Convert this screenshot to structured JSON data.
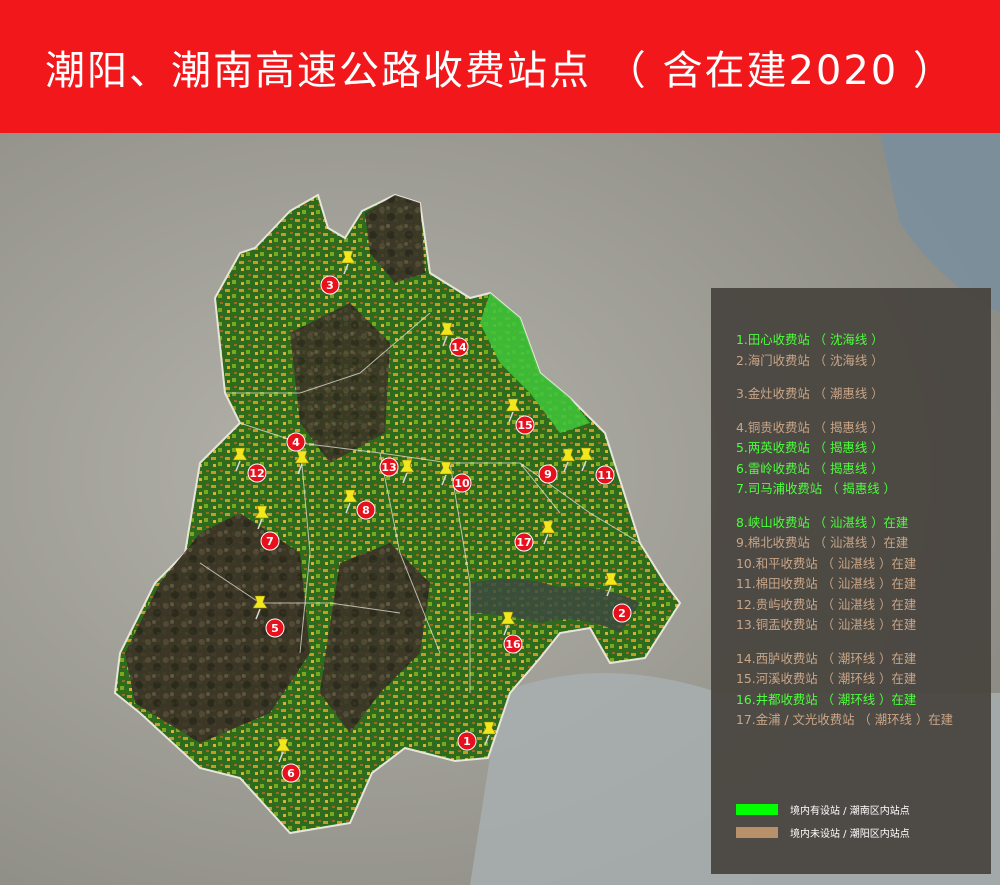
{
  "title": "潮阳、潮南高速公路收费站点 （ 含在建2020 ）",
  "colors": {
    "title_bar": "#f1171a",
    "green_text": "#4cff3c",
    "tan_text": "#c9a688",
    "legend_bg": "#46423d",
    "marker": "#e8101c",
    "pin": "#f2e61c",
    "key_green": "#00ff00",
    "key_tan": "#b8906a"
  },
  "legend": {
    "groups": [
      [
        {
          "text": "1.田心收费站 （ 沈海线 ）",
          "color": "green"
        },
        {
          "text": "2.海门收费站 （ 沈海线 ）",
          "color": "tan"
        }
      ],
      [
        {
          "text": "3.金灶收费站 （ 潮惠线 ）",
          "color": "tan"
        }
      ],
      [
        {
          "text": "4.铜贵收费站 （ 揭惠线 ）",
          "color": "tan"
        },
        {
          "text": "5.两英收费站 （ 揭惠线 ）",
          "color": "green"
        },
        {
          "text": "6.雷岭收费站 （ 揭惠线 ）",
          "color": "green"
        },
        {
          "text": "7.司马浦收费站 （ 揭惠线 ）",
          "color": "green"
        }
      ],
      [
        {
          "text": "8.峡山收费站 （ 汕湛线 ）在建",
          "color": "green"
        },
        {
          "text": "9.棉北收费站 （ 汕湛线 ）在建",
          "color": "tan"
        },
        {
          "text": "10.和平收费站 （ 汕湛线 ）在建",
          "color": "tan"
        },
        {
          "text": "11.棉田收费站 （ 汕湛线 ）在建",
          "color": "tan"
        },
        {
          "text": "12.贵屿收费站 （ 汕湛线 ）在建",
          "color": "tan"
        },
        {
          "text": "13.铜盂收费站 （ 汕湛线 ）在建",
          "color": "tan"
        }
      ],
      [
        {
          "text": "14.西胪收费站 （ 潮环线 ）在建",
          "color": "tan"
        },
        {
          "text": "15.河溪收费站 （ 潮环线 ）在建",
          "color": "tan"
        },
        {
          "text": "16.井都收费站 （ 潮环线 ）在建",
          "color": "green"
        },
        {
          "text": "17.金浦 / 文光收费站 （ 潮环线 ）在建",
          "color": "tan"
        }
      ]
    ],
    "keys": [
      {
        "label": "境内有设站 / 潮南区内站点",
        "color": "#00ff00"
      },
      {
        "label": "境内未设站 / 潮阳区内站点",
        "color": "#b8906a"
      }
    ]
  },
  "markers": [
    {
      "num": "1"
    },
    {
      "num": "2"
    },
    {
      "num": "3"
    },
    {
      "num": "4"
    },
    {
      "num": "5"
    },
    {
      "num": "6"
    },
    {
      "num": "7"
    },
    {
      "num": "8"
    },
    {
      "num": "9"
    },
    {
      "num": "10"
    },
    {
      "num": "11"
    },
    {
      "num": "12"
    },
    {
      "num": "13"
    },
    {
      "num": "14"
    },
    {
      "num": "15"
    },
    {
      "num": "16"
    },
    {
      "num": "17"
    }
  ]
}
